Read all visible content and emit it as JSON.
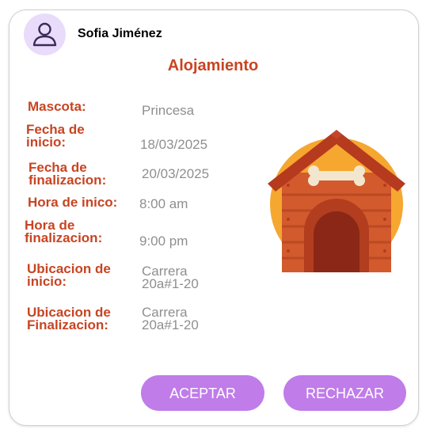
{
  "user": {
    "name": "Sofia Jiménez"
  },
  "title": "Alojamiento",
  "fields": {
    "mascota": {
      "label": "Mascota:",
      "value": "Princesa"
    },
    "fecha_inicio": {
      "label": "Fecha de\ninicio:",
      "value": "18/03/2025"
    },
    "fecha_fin": {
      "label": "Fecha de\nfinalizacion:",
      "value": "20/03/2025"
    },
    "hora_inicio": {
      "label": "Hora de inico:",
      "value": "8:00 am"
    },
    "hora_fin": {
      "label": "Hora de\nfinalizacion:",
      "value": "9:00 pm"
    },
    "ubicacion_inicio": {
      "label": "Ubicacion de\ninicio:",
      "value": "Carrera\n20a#1-20"
    },
    "ubicacion_fin": {
      "label": "Ubicacion de\nFinalizacion:",
      "value": "Carrera\n20a#1-20"
    }
  },
  "actions": {
    "accept": "ACEPTAR",
    "reject": "RECHAZAR"
  },
  "icons": {
    "avatar": "user-icon",
    "illustration": "dog-house-icon"
  },
  "colors": {
    "accent": "#c84422",
    "button": "#c07ce9",
    "avatar_bg": "#e9dcfb",
    "value_text": "#8f8f8f"
  }
}
